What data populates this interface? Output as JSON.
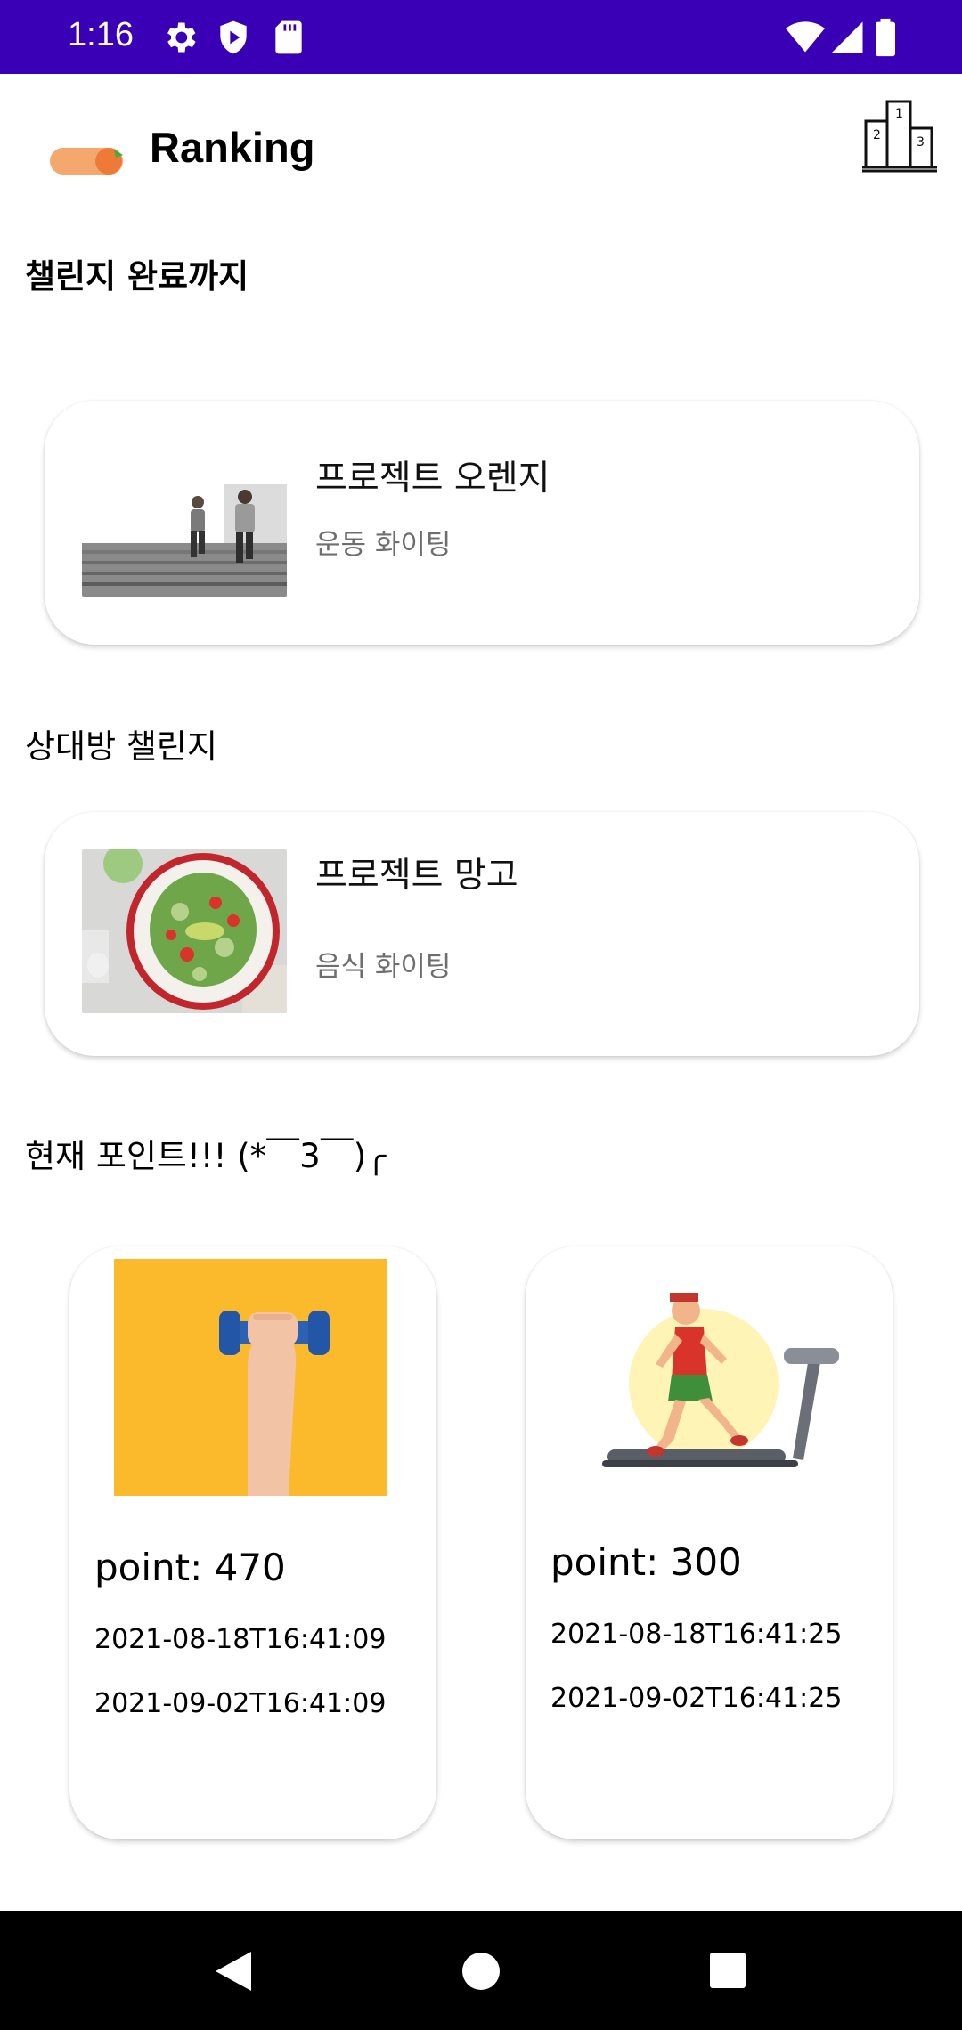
{
  "status_bar": {
    "time": "1:16",
    "color": "#3A00B6"
  },
  "header": {
    "title": "Ranking",
    "left_icon": "toggle-icon",
    "right_icon": "podium-icon"
  },
  "sections": {
    "until_complete": "챌린지 완료까지",
    "opponent": "상대방 챌린지",
    "current_points": "현재 포인트!!! (*￣3￣)╭"
  },
  "challenges": [
    {
      "title": "프로젝트 오렌지",
      "subtitle": "운동 화이팅",
      "image": "running-stairs-image"
    },
    {
      "title": "프로젝트 망고",
      "subtitle": "음식 화이팅",
      "image": "salad-image"
    }
  ],
  "point_cards": [
    {
      "point": "point: 470",
      "start": "2021-08-18T16:41:09",
      "end": "2021-09-02T16:41:09",
      "image": "dumbbell-image"
    },
    {
      "point": "point: 300",
      "start": "2021-08-18T16:41:25",
      "end": "2021-09-02T16:41:25",
      "image": "treadmill-image"
    }
  ]
}
